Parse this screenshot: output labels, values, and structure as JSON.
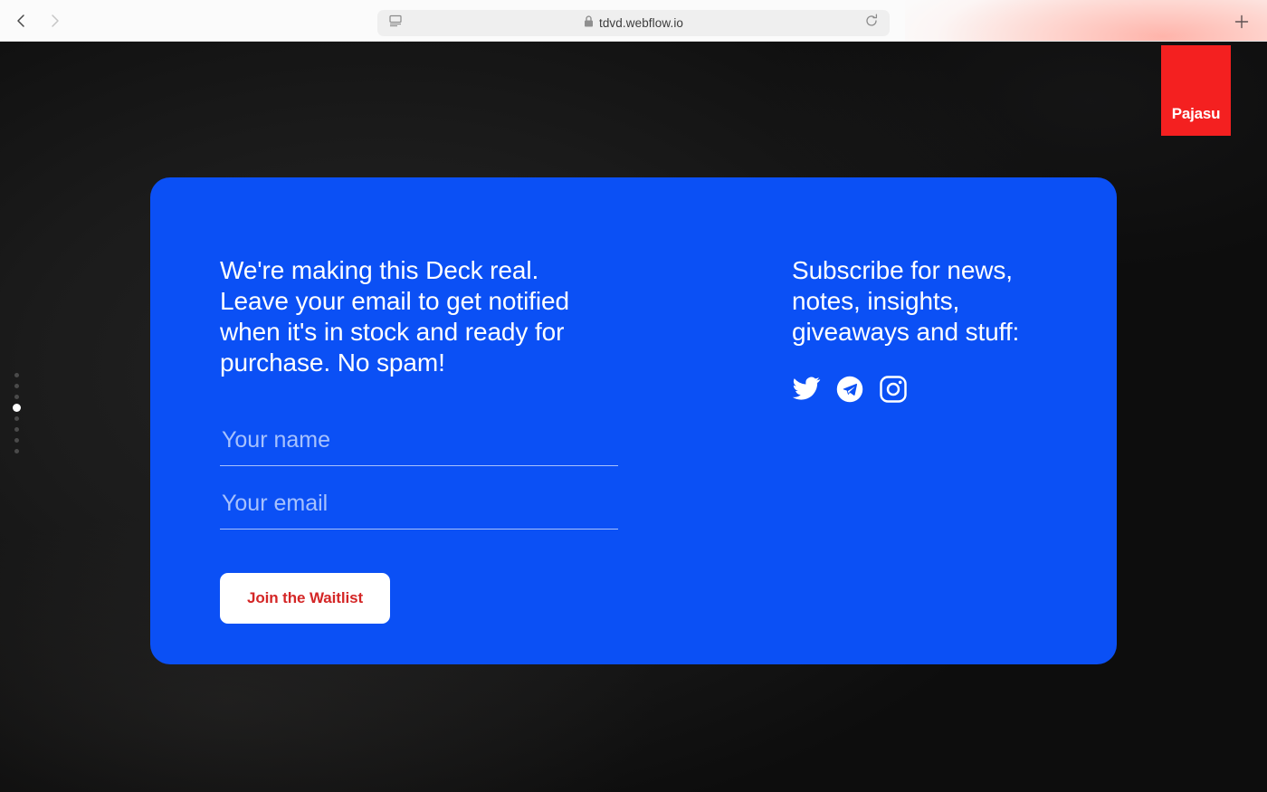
{
  "browser": {
    "back_icon": "chevron-left-icon",
    "forward_icon": "chevron-right-icon",
    "reader_icon": "reader-view-icon",
    "lock_icon": "lock-icon",
    "url": "tdvd.webflow.io",
    "reload_icon": "reload-icon",
    "newtab_icon": "plus-icon",
    "tab_tint": "#ffb0a6"
  },
  "page": {
    "background_color": "#1b1b1b",
    "brand": {
      "name": "Pajasu",
      "badge_color": "#f42020",
      "text_color": "#ffffff"
    },
    "dot_nav": {
      "total": 8,
      "active_index": 4,
      "active_color": "#ffffff",
      "inactive_color": "#4a4a4a"
    },
    "card": {
      "background_color": "#0b50f5",
      "corner_radius": 22,
      "left": {
        "headline": "We're making this Deck real. Leave your email to get notified when it's in stock and ready for purchase. No spam!",
        "form": {
          "name_placeholder": "Your name",
          "name_value": "",
          "email_placeholder": "Your email",
          "email_value": "",
          "submit_label": "Join the Waitlist",
          "submit_bg": "#ffffff",
          "submit_text_color": "#d42626"
        }
      },
      "right": {
        "subhead": "Subscribe for news, notes, insights, giveaways and stuff:",
        "social": [
          {
            "name": "twitter",
            "icon": "twitter-icon",
            "label": "Twitter"
          },
          {
            "name": "telegram",
            "icon": "telegram-icon",
            "label": "Telegram"
          },
          {
            "name": "instagram",
            "icon": "instagram-icon",
            "label": "Instagram"
          }
        ]
      }
    }
  }
}
